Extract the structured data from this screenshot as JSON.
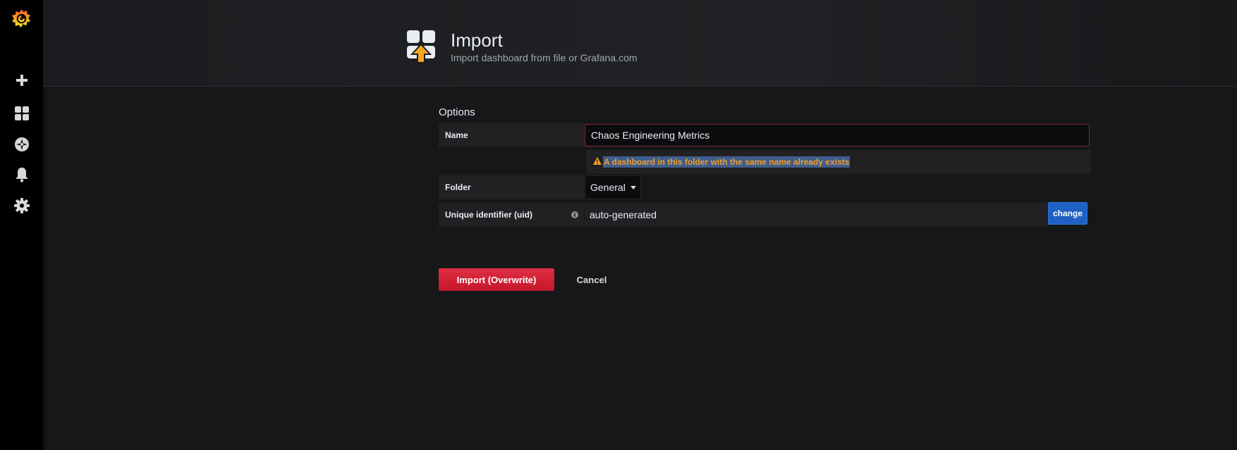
{
  "header": {
    "title": "Import",
    "subtitle": "Import dashboard from file or Grafana.com"
  },
  "sidebar": {
    "items": [
      {
        "icon": "grafana-logo"
      },
      {
        "icon": "plus-icon"
      },
      {
        "icon": "dashboards-icon"
      },
      {
        "icon": "explore-compass-icon"
      },
      {
        "icon": "bell-icon"
      },
      {
        "icon": "gear-icon"
      }
    ]
  },
  "options": {
    "section_title": "Options",
    "name_label": "Name",
    "name_value": "Chaos Engineering Metrics",
    "name_warning": "A dashboard in this folder with the same name already exists",
    "folder_label": "Folder",
    "folder_value": "General",
    "uid_label": "Unique identifier (uid)",
    "uid_value": "auto-generated",
    "uid_change_label": "change"
  },
  "actions": {
    "import_label": "Import (Overwrite)",
    "cancel_label": "Cancel"
  },
  "colors": {
    "background": "#161719",
    "sidebar": "#000000",
    "primary_blue": "#1f60c4",
    "danger_red": "#e02f44",
    "warning_orange": "#f29d2a",
    "logo_orange": "#f46800"
  }
}
